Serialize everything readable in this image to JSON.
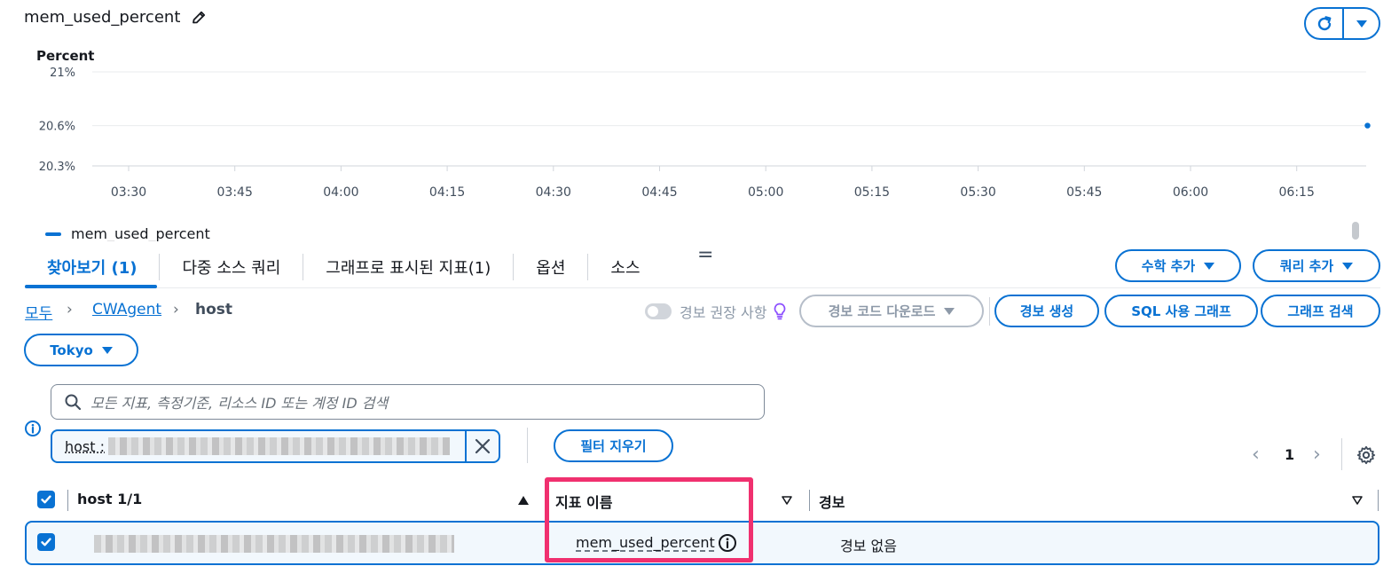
{
  "widget": {
    "title": "mem_used_percent"
  },
  "chart_data": {
    "type": "line",
    "ylabel": "Percent",
    "y_ticks": [
      "21%",
      "20.6%",
      "20.3%"
    ],
    "y_tick_values": [
      21,
      20.6,
      20.3
    ],
    "ylim": [
      20.3,
      21
    ],
    "x_ticks": [
      "03:30",
      "03:45",
      "04:00",
      "04:15",
      "04:30",
      "04:45",
      "05:00",
      "05:15",
      "05:30",
      "05:45",
      "06:00",
      "06:15"
    ],
    "series": [
      {
        "name": "mem_used_percent",
        "color": "#0972d3",
        "points": [
          {
            "x": "06:25",
            "y": 20.6
          }
        ]
      }
    ],
    "grid": "horizontal",
    "legend": "bottom-left"
  },
  "tabs": [
    {
      "label": "찾아보기 (1)",
      "active": true
    },
    {
      "label": "다중 소스 쿼리",
      "active": false
    },
    {
      "label": "그래프로 표시된 지표(1)",
      "active": false
    },
    {
      "label": "옵션",
      "active": false
    },
    {
      "label": "소스",
      "active": false
    }
  ],
  "tab_more_label": "=",
  "actions": {
    "math": "수학 추가",
    "query": "쿼리 추가"
  },
  "breadcrumb": {
    "all": "모두",
    "namespace": "CWAgent",
    "current": "host"
  },
  "alarm_recommendations": "경보 권장 사항",
  "buttons": {
    "download": "경보 코드 다운로드",
    "create_alarm": "경보 생성",
    "sql_graph": "SQL 사용 그래프",
    "graph_search": "그래프 검색",
    "clear_filter": "필터 지우기"
  },
  "region": "Tokyo",
  "search": {
    "placeholder": "모든 지표, 측정기준, 리소스 ID 또는 계정 ID 검색"
  },
  "filter_token": {
    "key": "host :"
  },
  "pagination": {
    "page": "1"
  },
  "table": {
    "headers": {
      "host": "host 1/1",
      "metric": "지표 이름",
      "alarm": "경보"
    },
    "rows": [
      {
        "metric": "mem_used_percent",
        "alarm": "경보 없음"
      }
    ]
  },
  "colors": {
    "accent": "#0972d3",
    "highlight": "#f0306f",
    "row_bg": "#f2f8fd"
  }
}
